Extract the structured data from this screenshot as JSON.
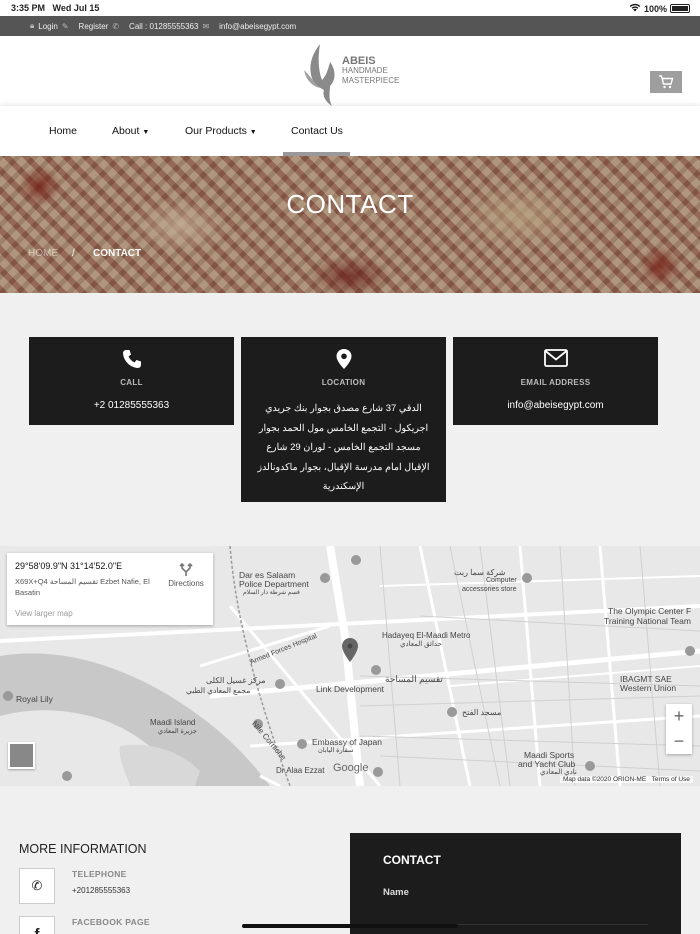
{
  "statusbar": {
    "time": "3:35 PM",
    "date": "Wed Jul 15",
    "battery": "100%"
  },
  "topbar": {
    "login": "Login",
    "register": "Register",
    "call": "Call : 01285555363",
    "email": "info@abeisegypt.com"
  },
  "logo": {
    "line1": "ABEIS",
    "line2": "HANDMADE",
    "line3": "MASTERPIECE"
  },
  "nav": {
    "home": "Home",
    "about": "About",
    "products": "Our Products",
    "contact": "Contact Us"
  },
  "banner": {
    "title": "CONTACT",
    "crumb_home": "HOME",
    "crumb_sep": "/",
    "crumb_current": "CONTACT"
  },
  "cards": {
    "call": {
      "title": "CALL",
      "value": "+2 01285555363"
    },
    "location": {
      "title": "LOCATION",
      "value": "الدقي 37 شارع مصدق بجوار بنك جريدي اجريكول - التجمع الخامس مول الحمد بجوار مسجد التجمع الخامس - لوران 29 شارع الإقبال امام مدرسة الإقبال، بجوار ماكدونالدز الإسكندرية"
    },
    "email": {
      "title": "EMAIL ADDRESS",
      "value": "info@abeisegypt.com"
    }
  },
  "map": {
    "coord": "29°58'09.9\"N 31°14'52.0\"E",
    "address": "X69X+Q4 تقسيم المساحة Ezbet Nafie, El Basatin",
    "directions": "Directions",
    "larger": "View larger map",
    "labels": {
      "dar": "Dar es Salaam",
      "police": "Police Department",
      "police_ar": "قسم شرطة دار السلام",
      "armed": "Armed Forces Hospital",
      "hadayeq": "Hadayeq El-Maadi Metro",
      "hadayeq_ar": "حدائق المعادي",
      "linkdev": "Link Development",
      "taqsim": "تقسيم المساحة",
      "royal": "Royal Lily",
      "maadi_island": "Maadi Island",
      "maadi_island_ar": "جزيرة المعادي",
      "embassy": "Embassy of Japan",
      "embassy_ar": "سفارة اليابان",
      "corniche": "Nile Corniche",
      "olympic": "The Olympic Center F",
      "olympic2": "Training National Team",
      "ibagmt": "IBAGMT SAE",
      "western": "Western Union",
      "maadi_sports": "Maadi Sports",
      "yacht": "and Yacht Club",
      "yacht_ar": "نادي المعادي",
      "hospital_ar": "مركز غسيل الكلى",
      "hospital2_ar": "مجمع المعادي الطبي",
      "alfath_ar": "مسجد الفتح",
      "sharika_ar": "شركة سما ربت",
      "computer": "Computer",
      "accessories": "accessories store",
      "ezzat": "Dr.Alaa Ezzat",
      "google": "Google",
      "footer": "Map data ©2020 ORION-ME",
      "terms": "Terms of Use"
    }
  },
  "more": {
    "title": "MORE INFORMATION",
    "telephone_label": "TELEPHONE",
    "telephone_value": "+201285555363",
    "facebook_label": "FACEBOOK PAGE"
  },
  "form": {
    "title": "CONTACT",
    "name_label": "Name"
  }
}
